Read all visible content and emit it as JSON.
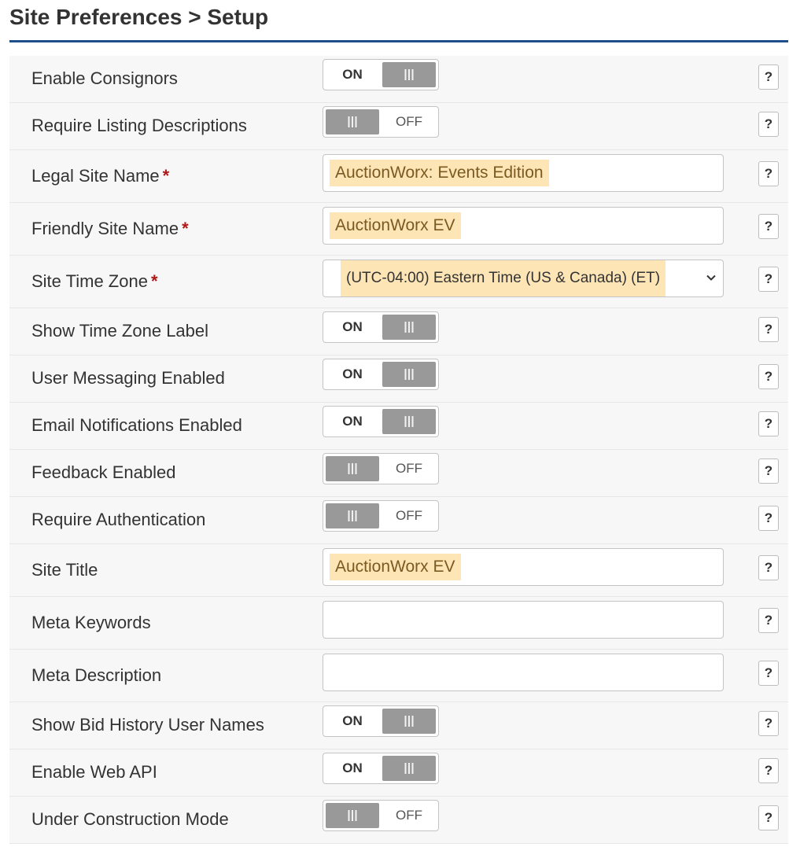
{
  "page": {
    "title": "Site Preferences > Setup"
  },
  "help_label": "?",
  "settings": [
    {
      "label": "Enable Consignors",
      "type": "toggle",
      "value": "ON"
    },
    {
      "label": "Require Listing Descriptions",
      "type": "toggle",
      "value": "OFF"
    },
    {
      "label": "Legal Site Name",
      "required": "*",
      "type": "text",
      "value": "AuctionWorx: Events Edition"
    },
    {
      "label": "Friendly Site Name",
      "required": "*",
      "type": "text",
      "value": "AuctionWorx EV"
    },
    {
      "label": "Site Time Zone",
      "required": "*",
      "type": "select",
      "value": "(UTC-04:00) Eastern Time (US & Canada) (ET)"
    },
    {
      "label": "Show Time Zone Label",
      "type": "toggle",
      "value": "ON"
    },
    {
      "label": "User Messaging Enabled",
      "type": "toggle",
      "value": "ON"
    },
    {
      "label": "Email Notifications Enabled",
      "type": "toggle",
      "value": "ON"
    },
    {
      "label": "Feedback Enabled",
      "type": "toggle",
      "value": "OFF"
    },
    {
      "label": "Require Authentication",
      "type": "toggle",
      "value": "OFF"
    },
    {
      "label": "Site Title",
      "type": "text",
      "value": "AuctionWorx EV"
    },
    {
      "label": "Meta Keywords",
      "type": "text",
      "value": ""
    },
    {
      "label": "Meta Description",
      "type": "text",
      "value": ""
    },
    {
      "label": "Show Bid History User Names",
      "type": "toggle",
      "value": "ON"
    },
    {
      "label": "Enable Web API",
      "type": "toggle",
      "value": "ON"
    },
    {
      "label": "Under Construction Mode",
      "type": "toggle",
      "value": "OFF"
    }
  ],
  "colors": {
    "title_rule": "#1f4e8c",
    "required_star": "#b01818",
    "autofill_highlight": "#fde5b6",
    "toggle_knob": "#999999",
    "row_background": "#f7f7f7"
  },
  "icons": {
    "help": "question-mark-icon",
    "select_arrow": "chevron-down-icon",
    "toggle_grip": "grip-lines-icon"
  }
}
